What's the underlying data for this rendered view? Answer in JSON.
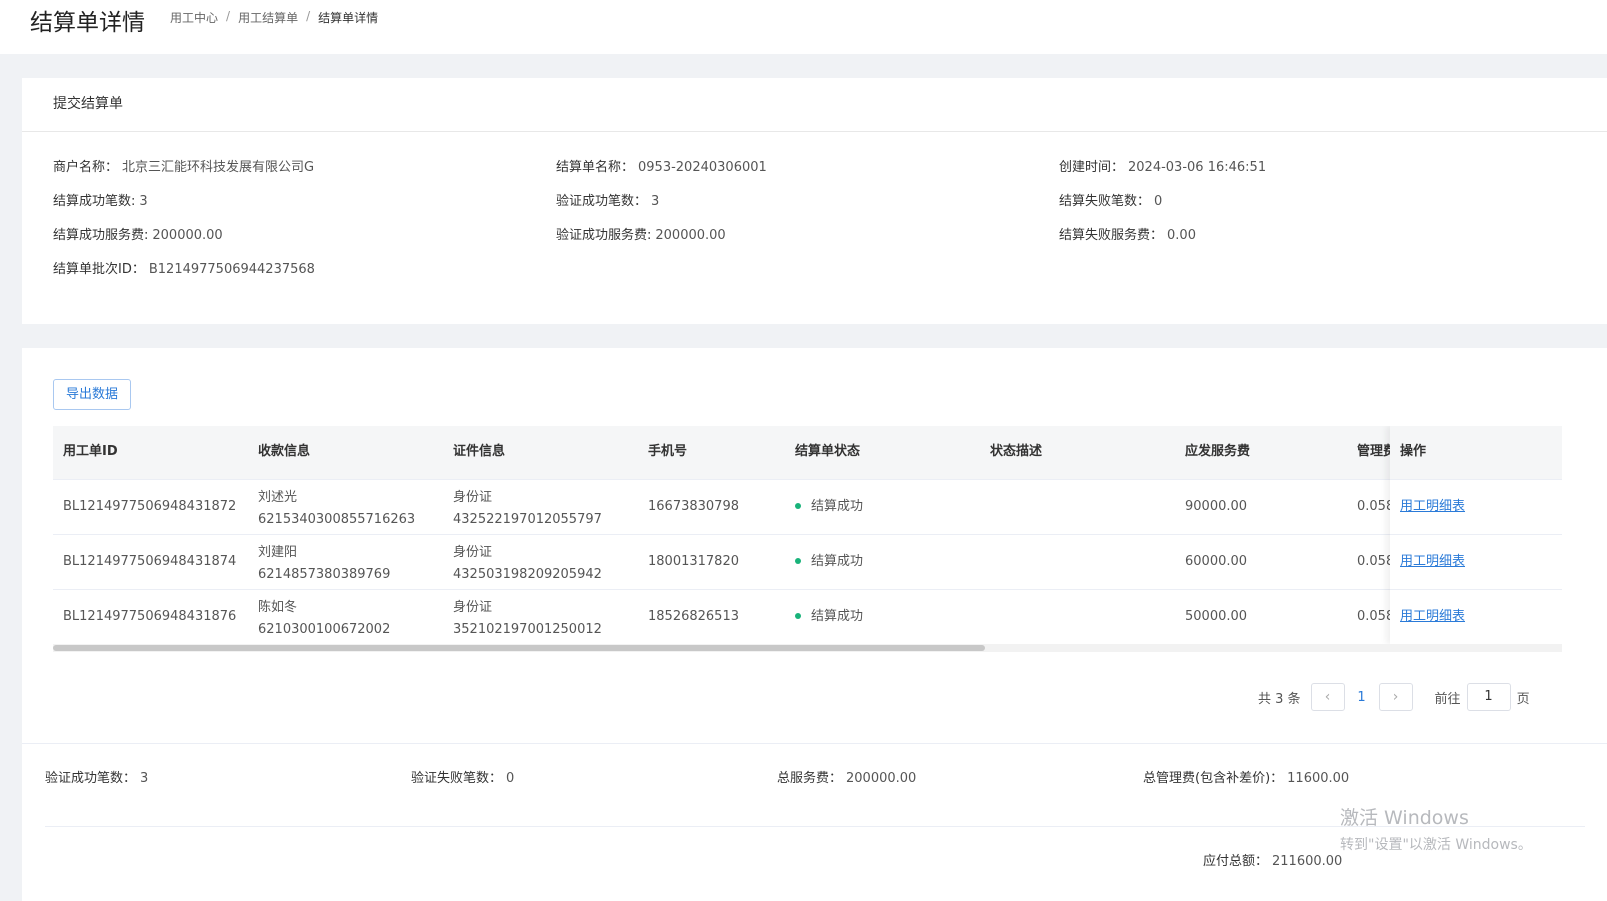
{
  "header": {
    "title": "结算单详情",
    "breadcrumb": [
      "用工中心",
      "用工结算单",
      "结算单详情"
    ],
    "separator": "/"
  },
  "summary_card": {
    "title": "提交结算单",
    "rows": [
      [
        {
          "label": "商户名称：",
          "value": "北京三汇能环科技发展有限公司G"
        },
        {
          "label": "结算单名称：",
          "value": "0953-20240306001"
        },
        {
          "label": "创建时间：",
          "value": "2024-03-06 16:46:51"
        }
      ],
      [
        {
          "label": "结算成功笔数:",
          "value": "3"
        },
        {
          "label": "验证成功笔数：",
          "value": "3"
        },
        {
          "label": "结算失败笔数：",
          "value": "0"
        }
      ],
      [
        {
          "label": "结算成功服务费:",
          "value": "200000.00"
        },
        {
          "label": "验证成功服务费:",
          "value": "200000.00"
        },
        {
          "label": "结算失败服务费：",
          "value": "0.00"
        }
      ],
      [
        {
          "label": "结算单批次ID：",
          "value": "B1214977506944237568"
        }
      ]
    ]
  },
  "toolbar": {
    "export_label": "导出数据"
  },
  "table": {
    "columns": [
      "用工单ID",
      "收款信息",
      "证件信息",
      "手机号",
      "结算单状态",
      "状态描述",
      "应发服务费",
      "管理费",
      "操作"
    ],
    "rows": [
      {
        "id": "BL1214977506948431872",
        "payee_name": "刘述光",
        "payee_account": "6215340300855716263",
        "cert_type": "身份证",
        "cert_no": "432522197012055797",
        "phone": "16673830798",
        "status": "结算成功",
        "status_desc": "",
        "service_fee": "90000.00",
        "mgmt_fee": "0.058",
        "action": "用工明细表"
      },
      {
        "id": "BL1214977506948431874",
        "payee_name": "刘建阳",
        "payee_account": "6214857380389769",
        "cert_type": "身份证",
        "cert_no": "432503198209205942",
        "phone": "18001317820",
        "status": "结算成功",
        "status_desc": "",
        "service_fee": "60000.00",
        "mgmt_fee": "0.058",
        "action": "用工明细表"
      },
      {
        "id": "BL1214977506948431876",
        "payee_name": "陈如冬",
        "payee_account": "6210300100672002",
        "cert_type": "身份证",
        "cert_no": "352102197001250012",
        "phone": "18526826513",
        "status": "结算成功",
        "status_desc": "",
        "service_fee": "50000.00",
        "mgmt_fee": "0.058",
        "action": "用工明细表"
      }
    ],
    "status_color": "#19b37a"
  },
  "pagination": {
    "total_text": "共 3 条",
    "current_page": "1",
    "goto_label": "前往",
    "goto_value": "1",
    "page_suffix": "页",
    "prev_icon": "‹",
    "next_icon": "›"
  },
  "totals": {
    "items": [
      {
        "label": "验证成功笔数：",
        "value": "3"
      },
      {
        "label": "验证失败笔数：",
        "value": "0"
      },
      {
        "label": "总服务费：",
        "value": "200000.00"
      },
      {
        "label": "总管理费(包含补差价)：",
        "value": "11600.00"
      }
    ],
    "payable": {
      "label": "应付总额：",
      "value": "211600.00"
    }
  },
  "watermark": {
    "line1": "激活 Windows",
    "line2": "转到\"设置\"以激活 Windows。"
  },
  "colors": {
    "accent": "#2a7ad8",
    "success": "#19b37a"
  }
}
